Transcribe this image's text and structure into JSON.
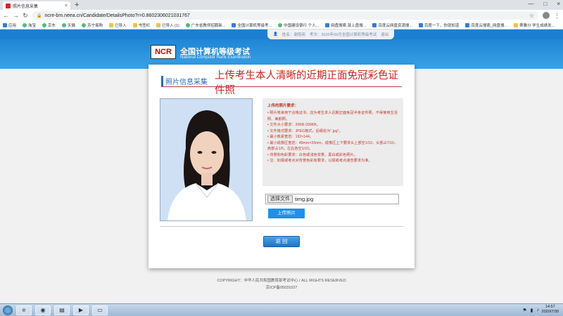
{
  "browser": {
    "tab_title": "照片信息采集",
    "new_tab_symbol": "+",
    "tab_close_symbol": "×",
    "window_min": "—",
    "window_max": "□",
    "window_close": "×",
    "url": "ncre-bm.neea.cn/Candidate/DetailsPhoto?r=0.8602306021031767",
    "bookmarks": [
      "应用",
      "淘宝",
      "京东",
      "天猫",
      "苏宁易购",
      "已导入",
      "书签栏",
      "已导入 (1)",
      "广东省教师招聘新...",
      "全国计算机等级考...",
      "中国建设银行 个人...",
      "网盘搜索,就上盘搜...",
      "百度云网盘资源搜...",
      "百度一下，你就知道",
      "百度云搜索_网盘搜...",
      "蒂雅分 学生成绩发..."
    ]
  },
  "header": {
    "user_name_label": "姓名：谢雨苑",
    "exam_label": "考次：2020年09月全国计算机等级考试",
    "logout_label": "退出",
    "logo_text": "NCR",
    "site_title": "全国计算机等级考试",
    "site_subtitle": "National Computer Rank Examination"
  },
  "panel": {
    "section_label": "照片信息采集",
    "heading": "上传考生本人清晰的近期正面免冠彩色证件照",
    "requirements_title": "上传的照片要求：",
    "requirements": [
      "• 照片将来用于合格证书，应为考生本人近期正面免冠半身证件照，不得使用生活照、美颜照。",
      "• 文件大小要求：20KB-200KB。",
      "• 文件格式要求：JPEG格式，后缀名为\".jpg\"。",
      "• 最小像素宽范：192×144。",
      "• 最小成像区宽范：48mm×33mm，成像区上下要求头上部空1/10，头部占7/10，肩部占1/5，左右各空1/10。",
      "• 背景和色彩要求：白色或浅色背景，黑白或彩色照片。",
      "• 注：如报或考点对背景色彩有要求，以报或考点通告要求为准。"
    ],
    "choose_file_label": "选择文件",
    "file_name": "timg.jpg",
    "upload_label": "上传照片",
    "back_label": "返 回"
  },
  "footer": {
    "copyright": "COPYRIGHT：中华人民共和国教育部考试中心 / ALL RIGHTS RESERVED",
    "icp": "京ICP备05031027"
  },
  "taskbar": {
    "time": "14:57",
    "date": "2020/7/30"
  }
}
